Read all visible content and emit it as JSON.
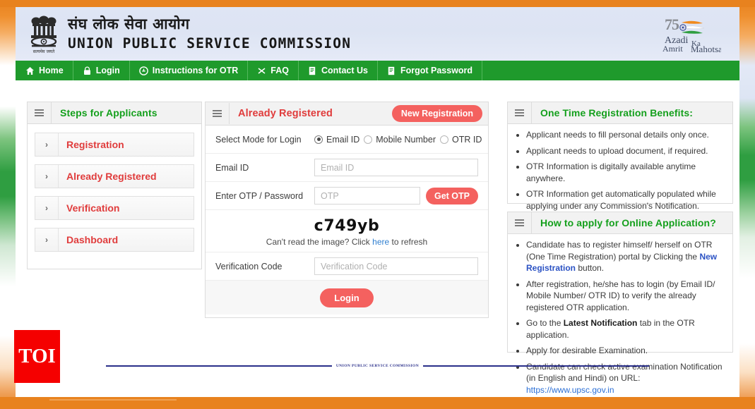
{
  "header": {
    "title_hindi": "संघ लोक सेवा आयोग",
    "title_english": "UNION PUBLIC SERVICE COMMISSION",
    "emblem_icon": "ashoka-lion-capital-emblem",
    "emblem_caption": "सत्यमेव जयते",
    "azadi_logo": {
      "number": "75",
      "line1": "Azadi",
      "line2": "Ka",
      "line3": "Amrit",
      "line4": "Mahotsav"
    }
  },
  "nav": {
    "items": [
      {
        "label": "Home",
        "icon": "home-icon"
      },
      {
        "label": "Login",
        "icon": "lock-icon"
      },
      {
        "label": "Instructions for OTR",
        "icon": "info-circle-icon"
      },
      {
        "label": "FAQ",
        "icon": "question-icon"
      },
      {
        "label": "Contact Us",
        "icon": "document-icon"
      },
      {
        "label": "Forgot Password",
        "icon": "document-icon"
      }
    ]
  },
  "steps_panel": {
    "title": "Steps for Applicants",
    "menu_icon": "hamburger-icon",
    "items": [
      {
        "label": "Registration",
        "arrow": "›"
      },
      {
        "label": "Already Registered",
        "arrow": "›"
      },
      {
        "label": "Verification",
        "arrow": "›"
      },
      {
        "label": "Dashboard",
        "arrow": "›"
      }
    ]
  },
  "login_panel": {
    "title": "Already Registered",
    "menu_icon": "hamburger-icon",
    "new_registration_label": "New Registration",
    "mode_label": "Select Mode for Login",
    "modes": [
      {
        "label": "Email ID",
        "selected": true
      },
      {
        "label": "Mobile Number",
        "selected": false
      },
      {
        "label": "OTR ID",
        "selected": false
      }
    ],
    "email_label": "Email ID",
    "email_value": "",
    "email_placeholder": "Email ID",
    "otp_label": "Enter OTP / Password",
    "otp_value": "",
    "otp_placeholder": "OTP",
    "get_otp_label": "Get OTP",
    "captcha_text": "c749yb",
    "captcha_help_pre": "Can't read the image? Click ",
    "captcha_help_link": "here",
    "captcha_help_post": " to refresh",
    "verification_label": "Verification Code",
    "verification_value": "",
    "verification_placeholder": "Verification Code",
    "login_label": "Login"
  },
  "benefits_panel": {
    "title": "One Time Registration Benefits:",
    "menu_icon": "hamburger-icon",
    "items": [
      "Applicant needs to fill personal details only once.",
      "Applicant needs to upload document, if required.",
      "OTR Information is digitally available anytime anywhere.",
      "OTR Information get automatically populated while applying under any Commission's Notification."
    ]
  },
  "howto_panel": {
    "title": "How to apply for Online Application?",
    "menu_icon": "hamburger-icon",
    "items": [
      {
        "pre": "Candidate has to register himself/ herself on OTR (One Time Registration) portal by Clicking the ",
        "highlight": "New Registration",
        "post": " button."
      },
      {
        "pre": "After registration, he/she has to login (by Email ID/ Mobile Number/ OTR ID) to verify the already registered OTR application.",
        "highlight": "",
        "post": ""
      },
      {
        "pre": "Go to the ",
        "highlight": "Latest Notification",
        "post": " tab in the OTR application."
      },
      {
        "pre": "Apply for desirable Examination.",
        "highlight": "",
        "post": ""
      },
      {
        "pre": "Candidate can check active examination Notification (in English and Hindi) on URL: ",
        "highlight": "",
        "post": "",
        "link": "https://www.upsc.gov.in"
      }
    ]
  },
  "footer": {
    "text": "UNION PUBLIC SERVICE COMMISSION"
  },
  "watermark": {
    "label": "TOI"
  },
  "colors": {
    "orange": "#e8821e",
    "nav_green": "#1f9a2c",
    "title_green": "#15a01d",
    "accent_red": "#e03c3c",
    "button_red": "#f4615f",
    "link_blue": "#2b6fd6",
    "footer_blue": "#2a2f8a"
  }
}
